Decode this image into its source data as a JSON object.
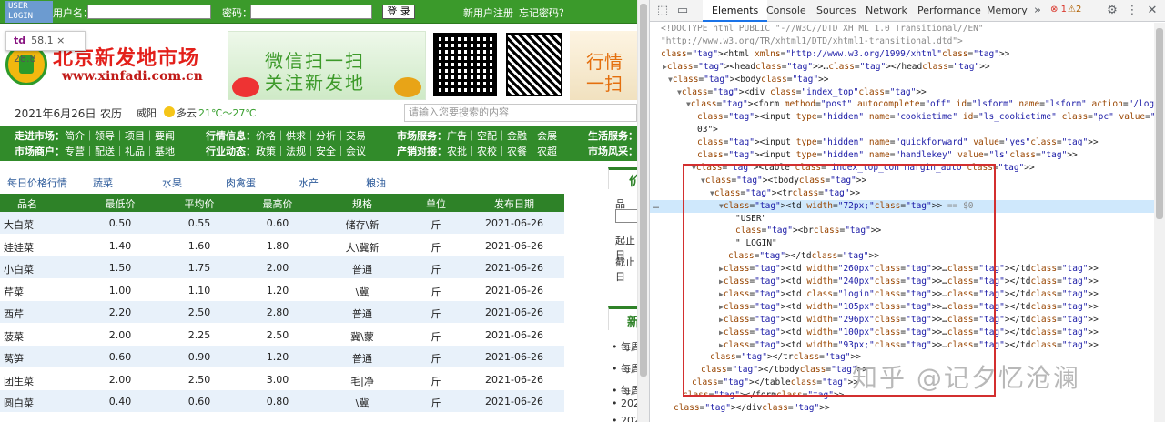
{
  "topbar": {
    "user_login_lines": [
      "USER",
      "LOGIN"
    ],
    "username_label": "用户名：",
    "password_label": "密码：",
    "login_button": "登 录",
    "register_link": "新用户注册",
    "forgot_link": "忘记密码？"
  },
  "tooltip": {
    "tag": "td",
    "size": "58.1 × 28.8"
  },
  "logo": {
    "name": "北京新发地市场",
    "url": "www.xinfadi.com.cn"
  },
  "banner1": {
    "line1": "微信扫一扫",
    "line2": "关注新发地"
  },
  "banner2": {
    "line1": "行情",
    "line2": "一扫"
  },
  "dateline": {
    "date": "2021年6月26日",
    "calendar": "农历",
    "city": "威阳",
    "weather": "多云",
    "temp": "21℃～27℃",
    "search_placeholder": "请输入您要搜索的内容"
  },
  "nav": {
    "row1": [
      {
        "head": "走进市场：",
        "items": "简介｜领导｜项目｜要闻"
      },
      {
        "head": "行情信息：",
        "items": "价格｜供求｜分析｜交易"
      },
      {
        "head": "市场服务：",
        "items": "广告｜空配｜金融｜会展"
      },
      {
        "head": "生活服务：",
        "items": "商"
      }
    ],
    "row2": [
      {
        "head": "市场商户：",
        "items": "专营｜配送｜礼品｜基地"
      },
      {
        "head": "行业动态：",
        "items": "政策｜法规｜安全｜会议"
      },
      {
        "head": "产销对接：",
        "items": "农批｜农校｜农餐｜农超"
      },
      {
        "head": "市场风采：",
        "items": "活"
      }
    ]
  },
  "categories": [
    "每日价格行情",
    "蔬菜",
    "水果",
    "肉禽蛋",
    "水产",
    "粮油"
  ],
  "price_table": {
    "headers": [
      "品名",
      "最低价",
      "平均价",
      "最高价",
      "规格",
      "单位",
      "发布日期"
    ],
    "rows": [
      [
        "大白菜",
        "0.50",
        "0.55",
        "0.60",
        "储存\\新",
        "斤",
        "2021-06-26"
      ],
      [
        "娃娃菜",
        "1.40",
        "1.60",
        "1.80",
        "大\\冀新",
        "斤",
        "2021-06-26"
      ],
      [
        "小白菜",
        "1.50",
        "1.75",
        "2.00",
        "普通",
        "斤",
        "2021-06-26"
      ],
      [
        "芹菜",
        "1.00",
        "1.10",
        "1.20",
        "\\冀",
        "斤",
        "2021-06-26"
      ],
      [
        "西芹",
        "2.20",
        "2.50",
        "2.80",
        "普通",
        "斤",
        "2021-06-26"
      ],
      [
        "菠菜",
        "2.00",
        "2.25",
        "2.50",
        "冀\\蒙",
        "斤",
        "2021-06-26"
      ],
      [
        "莴笋",
        "0.60",
        "0.90",
        "1.20",
        "普通",
        "斤",
        "2021-06-26"
      ],
      [
        "团生菜",
        "2.00",
        "2.50",
        "3.00",
        "毛|净",
        "斤",
        "2021-06-26"
      ],
      [
        "圆白菜",
        "0.40",
        "0.60",
        "0.80",
        "\\冀",
        "斤",
        "2021-06-26"
      ]
    ]
  },
  "sidebar": {
    "box1_title": "价",
    "box1_texts": [
      "品",
      "起止日",
      "截止日"
    ],
    "box2_title": "新",
    "list": [
      "每周",
      "每周",
      "每周",
      "2021",
      "2021"
    ]
  },
  "devtools": {
    "tabs": [
      "Elements",
      "Console",
      "Sources",
      "Network",
      "Performance",
      "Memory"
    ],
    "more": "»",
    "errors": "1",
    "warnings": "2",
    "dom_lines": [
      "<!DOCTYPE html PUBLIC \"-//W3C//DTD XHTML 1.0 Transitional//EN\"",
      "\"http://www.w3.org/TR/xhtml1/DTD/xhtml1-transitional.dtd\">",
      "<html xmlns=\"http://www.w3.org/1999/xhtml\">",
      "▶<head>…</head>",
      "▼<body>",
      "▼<div class=\"index_top\">",
      "▼<form method=\"post\" autocomplete=\"off\" id=\"lsform\" name=\"lsform\" action=\"/login.shtml\">",
      "<input type=\"hidden\" name=\"cookietime\" id=\"ls_cookietime\" class=\"pc\" value=\"0\" tabindex=\"9",
      "03\">",
      "<input type=\"hidden\" name=\"quickforward\" value=\"yes\">",
      "<input type=\"hidden\" name=\"handlekey\" value=\"ls\">",
      "▼<table class=\"index_top_con margin_auto\">",
      "▼<tbody>",
      "▼<tr>",
      "▼<td width=\"72px;\"> == $0",
      "\"USER\"",
      "<br>",
      "\" LOGIN\"",
      "</td>",
      "▶<td width=\"260px\">…</td>",
      "▶<td width=\"240px\">…</td>",
      "▶<td class=\"login\">…</td>",
      "▶<td width=\"105px\">…</td>",
      "▶<td width=\"296px\">…</td>",
      "▶<td width=\"100px\">…</td>",
      "▶<td width=\"93px;\">…</td>",
      "</tr>",
      "</tbody>",
      "</table>",
      "</form>",
      "</div>"
    ],
    "selected_marker": "…"
  },
  "watermark": "知乎 @记夕忆沧澜",
  "colors": {
    "brand_green": "#318b2a",
    "devtools_accent": "#1a73e8",
    "highlight_box": "#d32f2f",
    "tag_purple": "#881280"
  }
}
